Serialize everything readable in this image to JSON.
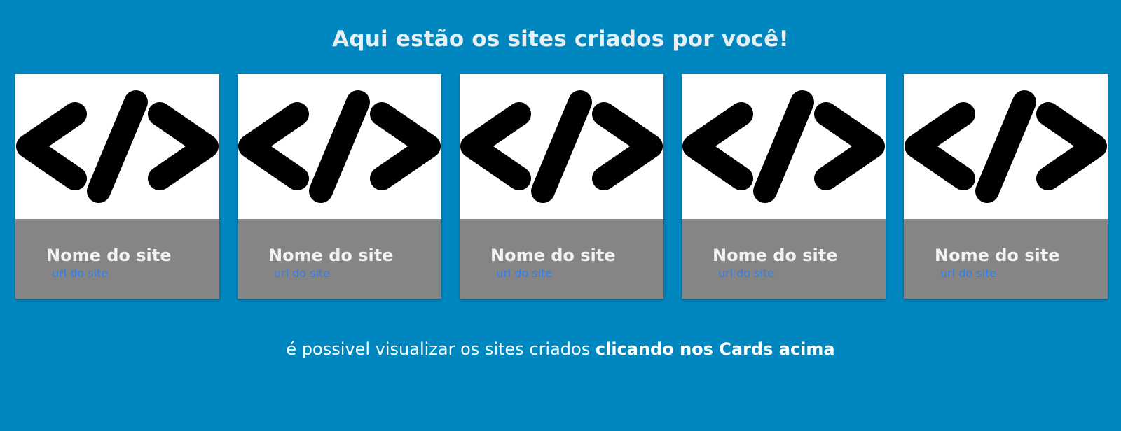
{
  "page": {
    "title": "Aqui estão os sites criados por você!",
    "background_color": "#0087bf",
    "footer_text_plain": "é possivel visualizar os sites criados ",
    "footer_text_bold": "clicando nos Cards acima"
  },
  "cards": [
    {
      "icon": "code-icon",
      "name": "Nome do site",
      "url": "url do site"
    },
    {
      "icon": "code-icon",
      "name": "Nome do site",
      "url": "url do site"
    },
    {
      "icon": "code-icon",
      "name": "Nome do site",
      "url": "url do site"
    },
    {
      "icon": "code-icon",
      "name": "Nome do site",
      "url": "url do site"
    },
    {
      "icon": "code-icon",
      "name": "Nome do site",
      "url": "url do site"
    }
  ],
  "colors": {
    "card_body": "#858585",
    "card_name": "#f2f2f2",
    "card_url": "#2f7ff0"
  }
}
